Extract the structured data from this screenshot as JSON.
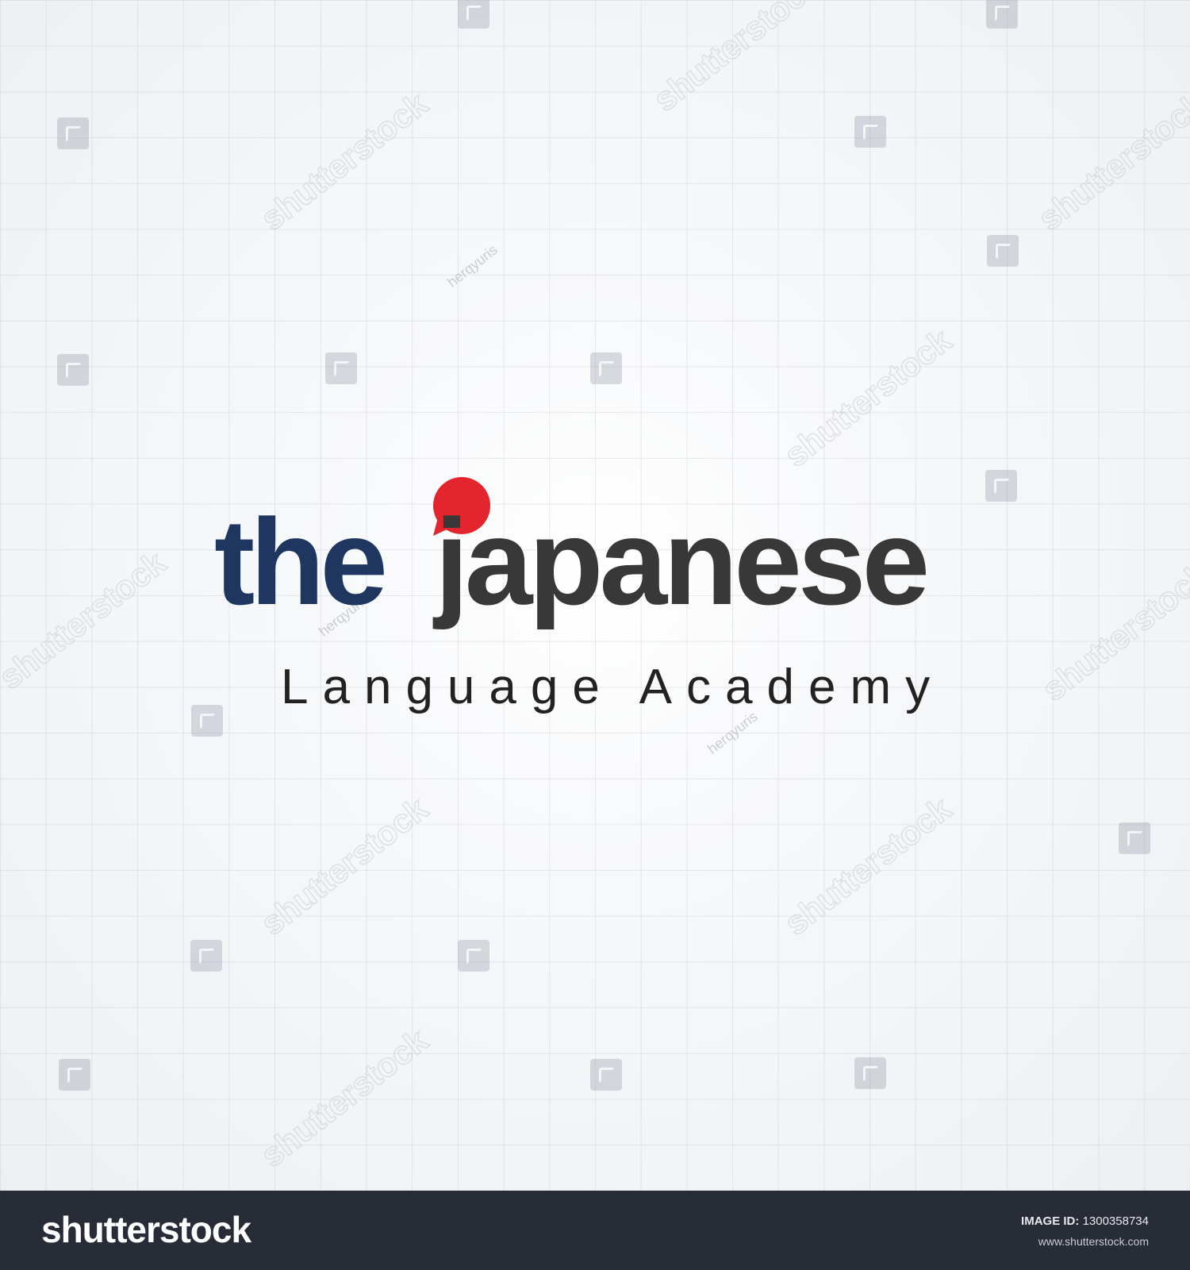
{
  "logo": {
    "word_the": "the",
    "word_japanese": "japanese",
    "tagline": "Language Academy",
    "colors": {
      "the": "#1f3660",
      "japanese": "#383838",
      "bubble": "#e3262d"
    },
    "icon": "speech-bubble-red-dot"
  },
  "watermark": {
    "brand": "shutterstock",
    "contributor": "herqyuris"
  },
  "footer": {
    "brand": "shutterstock",
    "image_id_label": "IMAGE ID:",
    "image_id_value": "1300358734",
    "site": "www.shutterstock.com"
  }
}
